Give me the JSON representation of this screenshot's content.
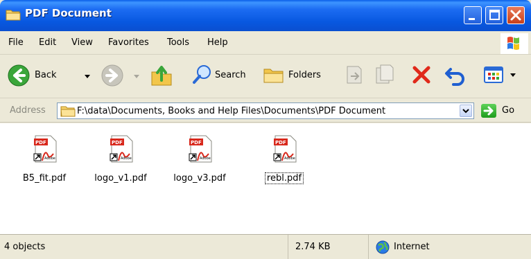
{
  "window": {
    "title": "PDF Document",
    "icons": {
      "folder": "folder-icon",
      "minimize": "minimize-icon",
      "maximize": "maximize-icon",
      "close": "close-icon"
    }
  },
  "menu": {
    "items": [
      "File",
      "Edit",
      "View",
      "Favorites",
      "Tools",
      "Help"
    ]
  },
  "toolbar": {
    "back_label": "Back",
    "search_label": "Search",
    "folders_label": "Folders"
  },
  "address": {
    "label": "Address",
    "path": "F:\\data\\Documents, Books and Help Files\\Documents\\PDF Document",
    "go_label": "Go"
  },
  "files": [
    {
      "name": "B5_fit.pdf",
      "selected": false
    },
    {
      "name": "logo_v1.pdf",
      "selected": false
    },
    {
      "name": "logo_v3.pdf",
      "selected": false
    },
    {
      "name": "rebl.pdf",
      "selected": true
    }
  ],
  "pdf_icon": {
    "badge": "PDF",
    "vendor": "Adobe"
  },
  "status": {
    "objects": "4 objects",
    "size": "2.74 KB",
    "zone": "Internet"
  },
  "colors": {
    "titlebar": "#0a5fe8",
    "close_button": "#c8401a",
    "pdf_red": "#d8281c",
    "go_green": "#1f9c1c"
  }
}
